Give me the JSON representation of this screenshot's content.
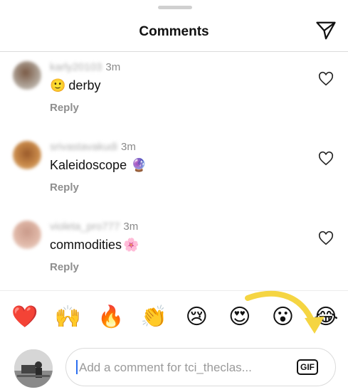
{
  "header": {
    "title": "Comments",
    "send_icon": "paper-plane-icon"
  },
  "comments": [
    {
      "username": "karly20103",
      "time": "3m",
      "text": "derby",
      "leading_emoji": "🙂",
      "trailing_emoji": "",
      "reply": "Reply"
    },
    {
      "username": "srivastavakudi",
      "time": "3m",
      "text": "Kaleidoscope",
      "leading_emoji": "",
      "trailing_emoji": "🔮",
      "reply": "Reply"
    },
    {
      "username": "violeta_pro777",
      "time": "3m",
      "text": "commodities",
      "leading_emoji": "",
      "trailing_emoji": "🌸",
      "reply": "Reply"
    }
  ],
  "emoji_bar": [
    "❤️",
    "🙌",
    "🔥",
    "👏",
    "😢",
    "😍",
    "😮",
    "😂"
  ],
  "composer": {
    "placeholder": "Add a comment for tci_theclas...",
    "gif_label": "GIF"
  },
  "colors": {
    "accent_arrow": "#f5d542",
    "caret": "#2b6ef0",
    "heart_emoji": "#e0202c"
  }
}
